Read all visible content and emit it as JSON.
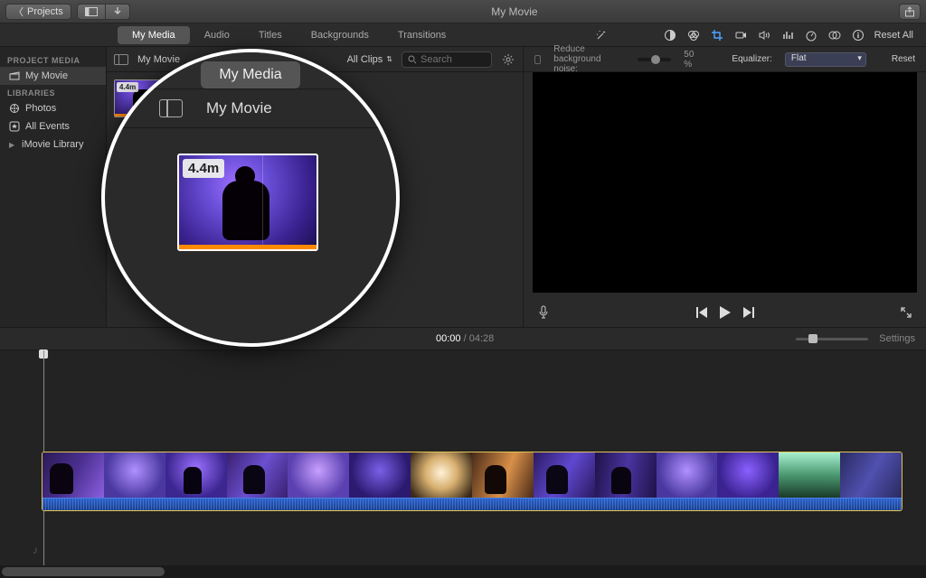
{
  "titlebar": {
    "projects_btn": "Projects",
    "window_title": "My Movie"
  },
  "tabs": {
    "my_media": "My Media",
    "audio": "Audio",
    "titles": "Titles",
    "backgrounds": "Backgrounds",
    "transitions": "Transitions"
  },
  "toolbar": {
    "reset_all": "Reset All"
  },
  "audio_adjust": {
    "reduce_noise_label": "Reduce background noise:",
    "noise_value": "50 %",
    "equalizer_label": "Equalizer:",
    "equalizer_value": "Flat",
    "reset": "Reset"
  },
  "sidebar": {
    "project_media_header": "PROJECT MEDIA",
    "libraries_header": "LIBRARIES",
    "my_movie": "My Movie",
    "photos": "Photos",
    "all_events": "All Events",
    "imovie_library": "iMovie Library"
  },
  "browser": {
    "title": "My Movie",
    "filter_label": "All Clips",
    "search_placeholder": "Search",
    "clip_duration": "4.4m"
  },
  "callout": {
    "tab_label": "My Media",
    "title": "My Movie",
    "clip_duration": "4.4m"
  },
  "timecode": {
    "current": "00:00",
    "sep": " / ",
    "total": "04:28"
  },
  "timeline": {
    "settings": "Settings"
  }
}
